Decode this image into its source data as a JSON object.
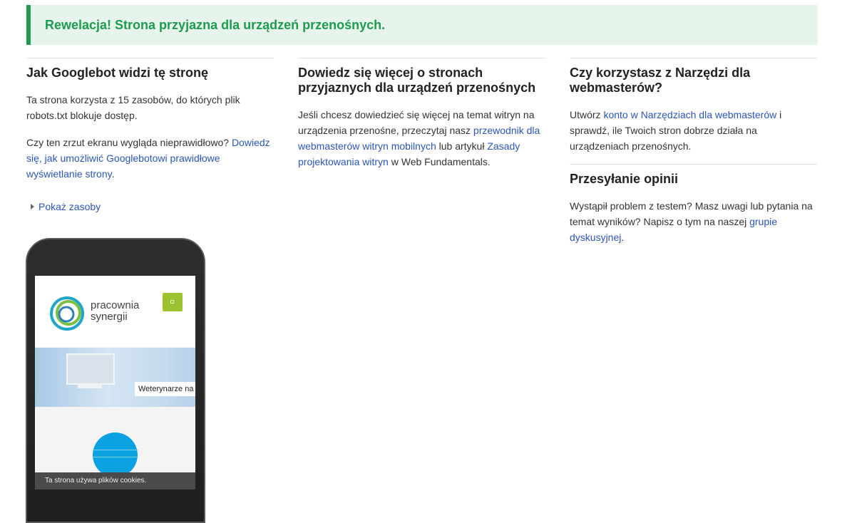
{
  "banner": {
    "text": "Rewelacja! Strona przyjazna dla urządzeń przenośnych."
  },
  "col1": {
    "title": "Jak Googlebot widzi tę stronę",
    "p1": "Ta strona korzysta z 15 zasobów, do których plik robots.txt blokuje dostęp.",
    "p2_text": "Czy ten zrzut ekranu wygląda nieprawidłowo? ",
    "p2_link": "Dowiedz się, jak umożliwić Googlebotowi prawidłowe wyświetlanie strony",
    "p2_end": ".",
    "show_resources": "Pokaż zasoby"
  },
  "col2": {
    "title": "Dowiedz się więcej o stronach przyjaznych dla urządzeń przenośnych",
    "t1": "Jeśli chcesz dowiedzieć się więcej na temat witryn na urządzenia przenośne, przeczytaj nasz ",
    "link1": "przewodnik dla webmasterów witryn mobilnych",
    "t2": " lub artykuł ",
    "link2": "Zasady projektowania witryn",
    "t3": " w Web Fundamentals."
  },
  "col3": {
    "title": "Czy korzystasz z Narzędzi dla webmasterów?",
    "t1": "Utwórz ",
    "link1": "konto w Narzędziach dla webmasterów",
    "t2": " i sprawdź, ile Twoich stron dobrze działa na urządzeniach przenośnych.",
    "feedback_title": "Przesyłanie opinii",
    "f1": "Wystąpił problem z testem? Masz uwagi lub pytania na temat wyników? Napisz o tym na naszej ",
    "flink": "grupie dyskusyjnej",
    "f2": "."
  },
  "phone": {
    "logo_line1": "pracownia",
    "logo_line2": "synergii",
    "hero_label": "Weterynarze na",
    "cookie_text": "Ta strona używa plików cookies."
  }
}
